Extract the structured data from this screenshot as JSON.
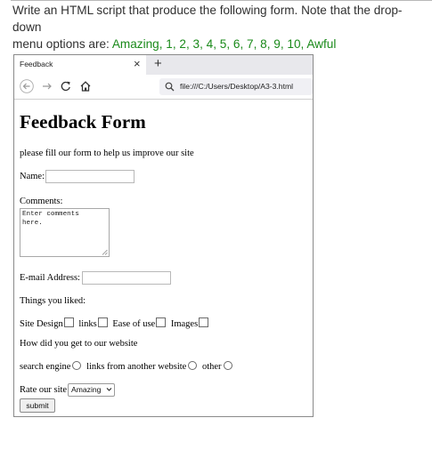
{
  "instruction": {
    "line1": "Write an HTML script that produce the following form. Note that the drop-down",
    "prefix": "menu options are: ",
    "options": [
      "Amazing",
      "1",
      "2",
      "3",
      "4",
      "5",
      "6",
      "7",
      "8",
      "9",
      "10",
      "Awful"
    ],
    "option_color": "#1a8a1a"
  },
  "browser": {
    "tab_title": "Feedback",
    "close_glyph": "×",
    "newtab_glyph": "+",
    "url": "file:///C:/Users/Desktop/A3-3.html",
    "icons": [
      "back-icon",
      "forward-icon",
      "reload-icon",
      "home-icon",
      "search-icon"
    ]
  },
  "form": {
    "title": "Feedback Form",
    "intro": "please fill our form to help us improve our site",
    "name_label": "Name:",
    "comments_label": "Comments:",
    "comments_value": "Enter comments\nhere.",
    "email_label": "E-mail Address:",
    "liked_label": "Things you liked:",
    "liked_options": [
      "Site Design",
      "links",
      "Ease of use",
      "Images"
    ],
    "how_label": "How did you get to our website",
    "how_options": [
      "search engine",
      "links from another website",
      "other"
    ],
    "rate_label": "Rate our site:",
    "rate_value": "Amazing",
    "submit_label": "submit"
  }
}
